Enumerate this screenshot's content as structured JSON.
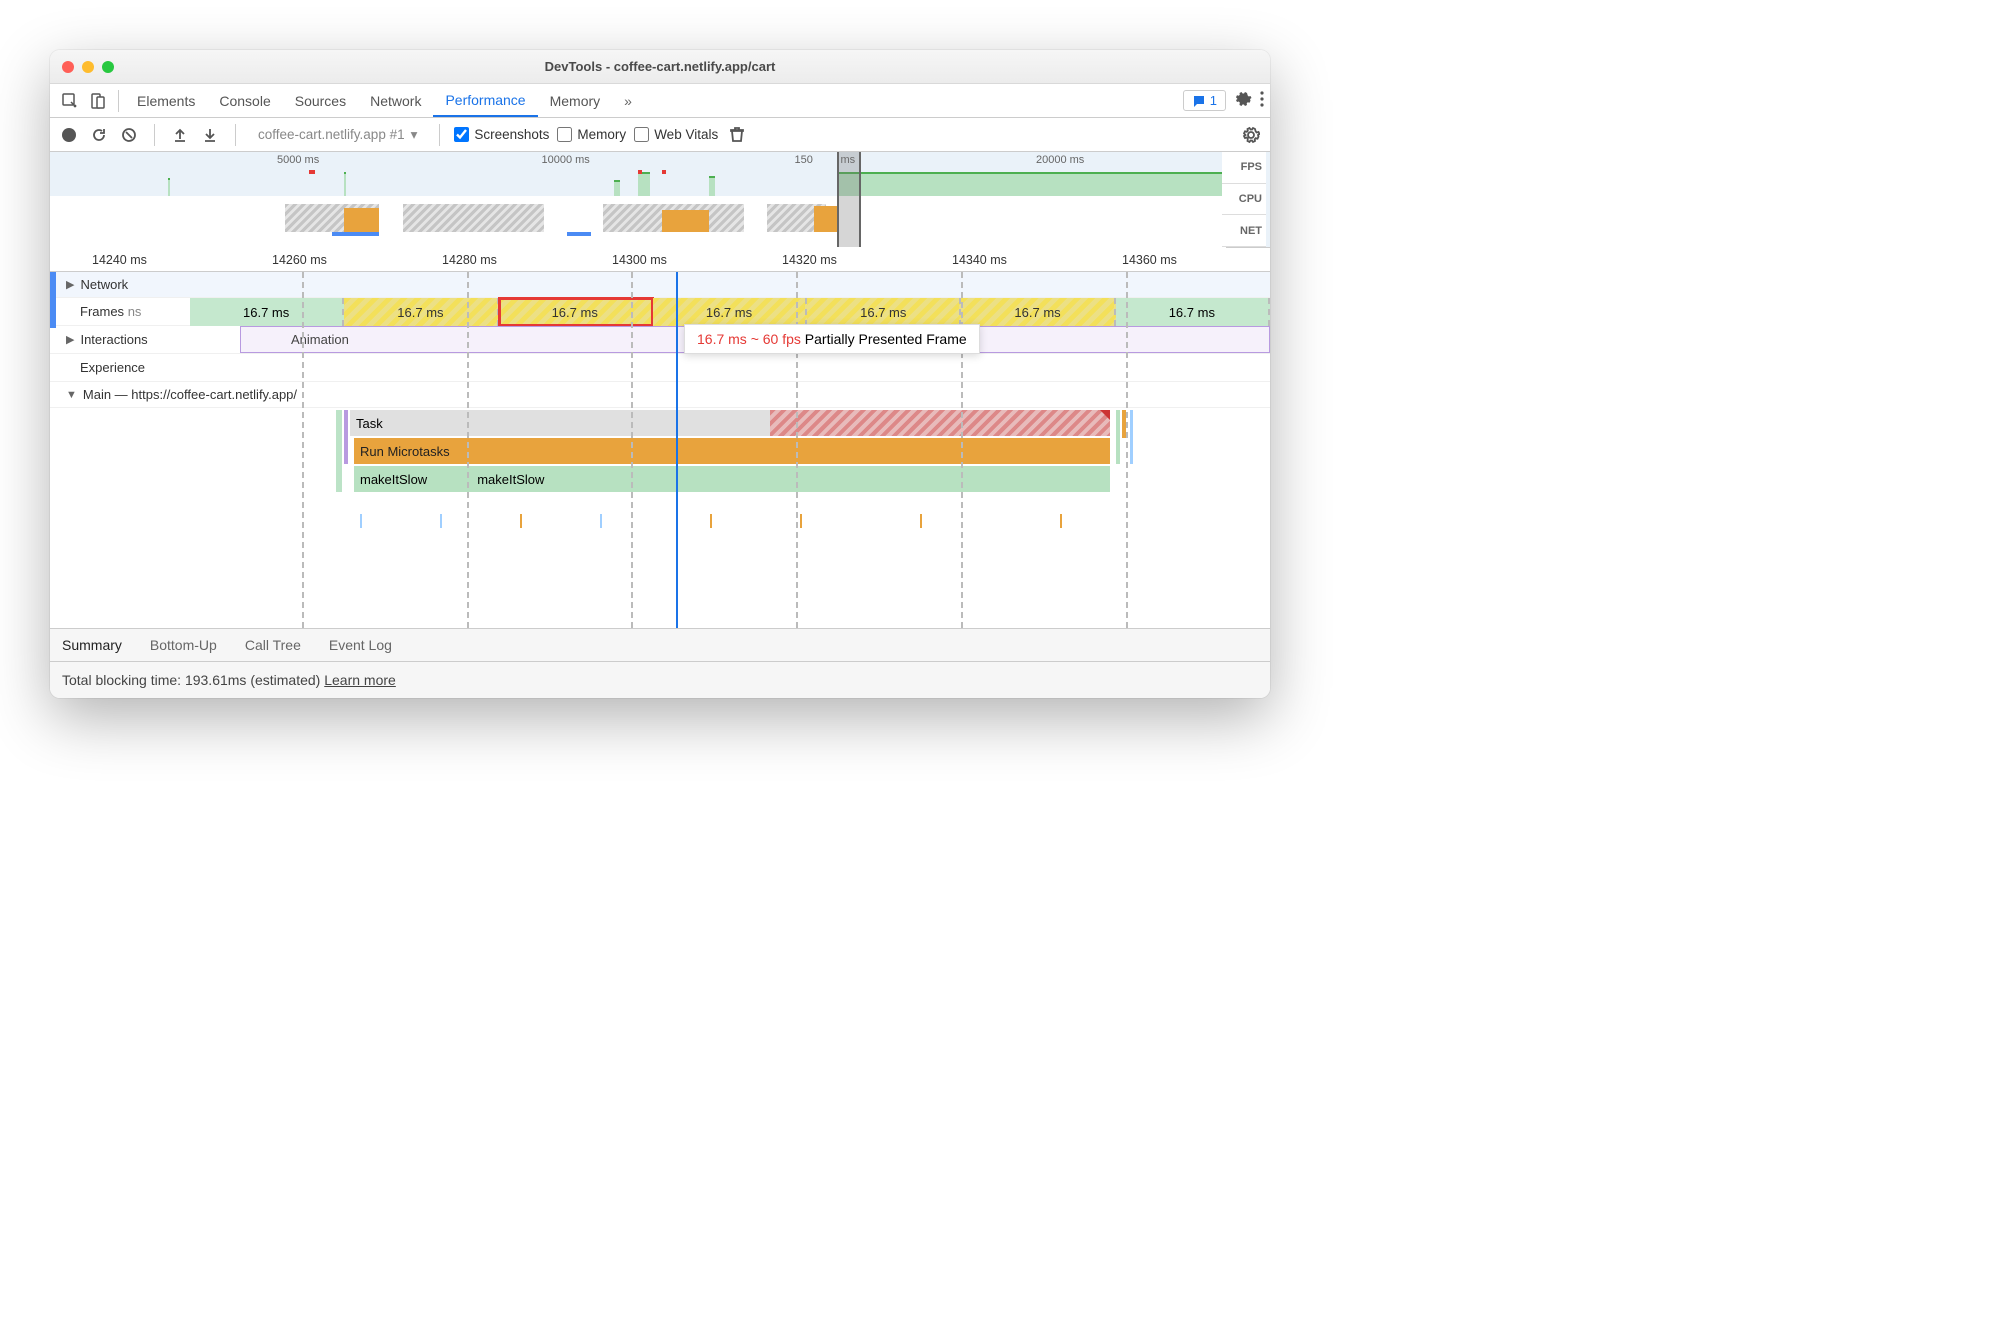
{
  "window": {
    "title": "DevTools - coffee-cart.netlify.app/cart"
  },
  "tabs": {
    "items": [
      "Elements",
      "Console",
      "Sources",
      "Network",
      "Performance",
      "Memory"
    ],
    "active": "Performance",
    "badge_count": "1"
  },
  "toolbar": {
    "recording_name": "coffee-cart.netlify.app #1",
    "cb_screenshots": "Screenshots",
    "cb_memory": "Memory",
    "cb_webvitals": "Web Vitals"
  },
  "overview": {
    "ticks": [
      "5000 ms",
      "10000 ms",
      "150",
      "ms",
      "20000 ms"
    ],
    "lanes": [
      "FPS",
      "CPU",
      "NET"
    ]
  },
  "ruler": [
    "14240 ms",
    "14260 ms",
    "14280 ms",
    "14300 ms",
    "14320 ms",
    "14340 ms",
    "14360 ms"
  ],
  "tracks": {
    "network": "Network",
    "frames": "Frames",
    "interactions": "Interactions",
    "experience": "Experience",
    "main": "Main — https://coffee-cart.netlify.app/"
  },
  "frames": {
    "overflow_label": "ns",
    "values": [
      "16.7 ms",
      "16.7 ms",
      "16.7 ms",
      "16.7 ms",
      "16.7 ms",
      "16.7 ms",
      "16.7 ms"
    ],
    "selected_index": 2
  },
  "interactions": {
    "animation": "Animation"
  },
  "tooltip": {
    "rate": "16.7 ms ~ 60 fps",
    "status": "Partially Presented Frame"
  },
  "flame": {
    "task": "Task",
    "microtasks": "Run Microtasks",
    "slow1": "makeItSlow",
    "slow2": "makeItSlow"
  },
  "bottom_tabs": [
    "Summary",
    "Bottom-Up",
    "Call Tree",
    "Event Log"
  ],
  "footer": {
    "blocking": "Total blocking time: 193.61ms (estimated)",
    "learn": "Learn more"
  }
}
